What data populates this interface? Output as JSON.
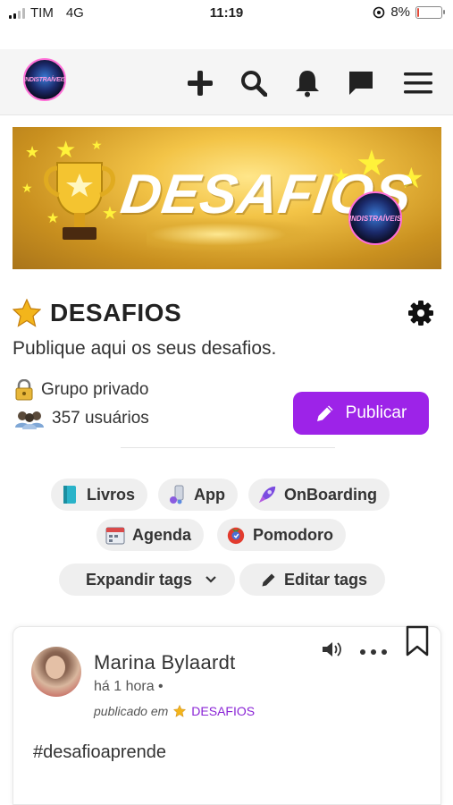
{
  "status_bar": {
    "carrier": "TIM",
    "network": "4G",
    "time": "11:19",
    "battery": "8%",
    "battery_level": 0.08
  },
  "header": {
    "logo_text": "INDISTRAÍVEIS",
    "icons": [
      "plus-icon",
      "search-icon",
      "bell-icon",
      "chat-icon",
      "menu-icon"
    ]
  },
  "banner": {
    "title": "DESAFIOS",
    "logo_text": "INDISTRAÍVEIS"
  },
  "group": {
    "name": "DESAFIOS",
    "description": "Publique aqui os seus desafios.",
    "privacy": "Grupo privado",
    "members": "357 usuários",
    "publish_label": "Publicar"
  },
  "tags": {
    "items": [
      {
        "label": "Livros",
        "icon": "book-icon"
      },
      {
        "label": "App",
        "icon": "app-icon"
      },
      {
        "label": "OnBoarding",
        "icon": "rocket-icon"
      },
      {
        "label": "Agenda",
        "icon": "calendar-icon"
      },
      {
        "label": "Pomodoro",
        "icon": "tomato-icon"
      }
    ],
    "expand_label": "Expandir tags",
    "edit_label": "Editar tags"
  },
  "post": {
    "author": "Marina Bylaardt",
    "time": "há 1 hora •",
    "posted_in_prefix": "publicado em",
    "group": "DESAFIOS",
    "body": "#desafioaprende"
  },
  "colors": {
    "accent": "#9d23e8",
    "group_link": "#8a24d6",
    "header_bg": "#f5f5f5",
    "tag_bg": "#efefef"
  }
}
